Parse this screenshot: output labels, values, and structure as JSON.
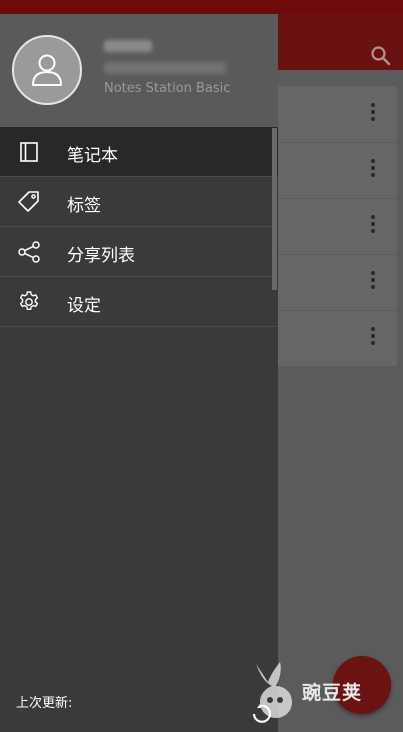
{
  "drawer": {
    "plan_label": "Notes Station Basic",
    "items": [
      {
        "label": "笔记本",
        "icon": "notebook-icon",
        "active": true
      },
      {
        "label": "标签",
        "icon": "tag-icon",
        "active": false
      },
      {
        "label": "分享列表",
        "icon": "share-icon",
        "active": false
      },
      {
        "label": "设定",
        "icon": "gear-icon",
        "active": false
      }
    ],
    "footer_label": "上次更新:"
  },
  "watermark": {
    "text": "豌豆荚"
  },
  "colors": {
    "app_bar": "#6a1111",
    "drawer_bg": "#3a3a3a",
    "drawer_header_bg": "#5a5a5a",
    "active_item_bg": "#282828",
    "fab": "#6b1212"
  }
}
